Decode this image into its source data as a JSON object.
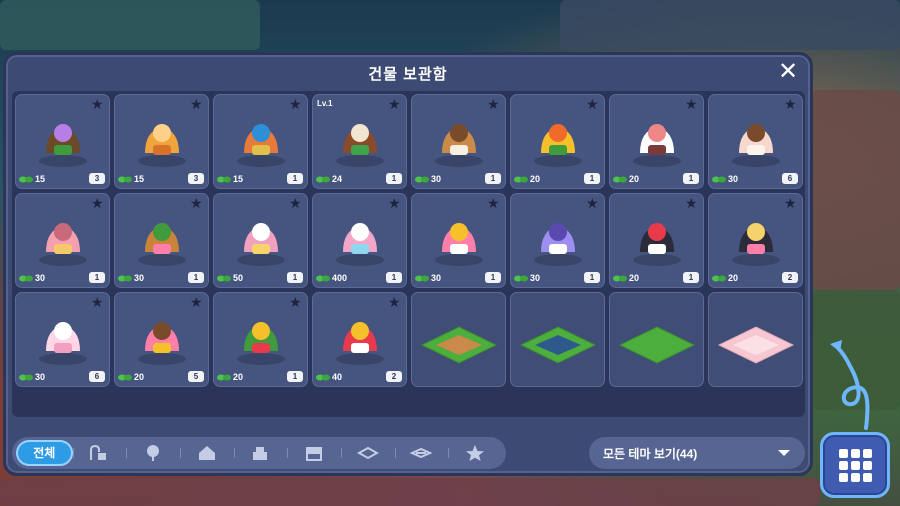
{
  "panel": {
    "title": "건물 보관함",
    "close_icon": "close-icon"
  },
  "items": [
    {
      "name": "flower-bed",
      "price": "15",
      "qty": "3",
      "level": "",
      "colors": [
        "#6b4a2a",
        "#3f9b3b",
        "#b77ee6"
      ]
    },
    {
      "name": "arch-bench",
      "price": "15",
      "qty": "3",
      "level": "",
      "colors": [
        "#f0a53c",
        "#d7722a",
        "#ffd08a"
      ]
    },
    {
      "name": "swing-set",
      "price": "15",
      "qty": "1",
      "level": "",
      "colors": [
        "#e57a3a",
        "#e0c04a",
        "#2d8fd6"
      ]
    },
    {
      "name": "gingerbread-house",
      "price": "24",
      "qty": "1",
      "level": "Lv.1",
      "colors": [
        "#8a4b2a",
        "#3fa34a",
        "#f3e6d0"
      ]
    },
    {
      "name": "sofa-bench",
      "price": "30",
      "qty": "1",
      "level": "",
      "colors": [
        "#c98a4a",
        "#f7efe0",
        "#7a4b2a"
      ]
    },
    {
      "name": "yellow-flowers",
      "price": "20",
      "qty": "1",
      "level": "",
      "colors": [
        "#f5c02a",
        "#3f9b3b",
        "#f06a2a"
      ]
    },
    {
      "name": "white-cat",
      "price": "20",
      "qty": "1",
      "level": "",
      "colors": [
        "#ffffff",
        "#7a3a3a",
        "#e88"
      ]
    },
    {
      "name": "cotton-tree",
      "price": "30",
      "qty": "6",
      "level": "",
      "colors": [
        "#f7d8cc",
        "#fff3ee",
        "#7a4b2a"
      ]
    },
    {
      "name": "pink-radio",
      "price": "30",
      "qty": "1",
      "level": "",
      "colors": [
        "#f5a0b0",
        "#f5c96a",
        "#c86a7a"
      ]
    },
    {
      "name": "flower-basket",
      "price": "30",
      "qty": "1",
      "level": "",
      "colors": [
        "#c9843a",
        "#ff7fa8",
        "#3f9b3b"
      ]
    },
    {
      "name": "picnic-mat",
      "price": "50",
      "qty": "1",
      "level": "",
      "colors": [
        "#f2a0c0",
        "#f7d36a",
        "#ffffff"
      ]
    },
    {
      "name": "cake-fountain",
      "price": "400",
      "qty": "1",
      "level": "",
      "colors": [
        "#f4a6c8",
        "#8fd6f0",
        "#ffffff"
      ]
    },
    {
      "name": "drum-set",
      "price": "30",
      "qty": "1",
      "level": "",
      "colors": [
        "#ff7fa8",
        "#ffffff",
        "#f5c02a"
      ]
    },
    {
      "name": "keyboard",
      "price": "30",
      "qty": "1",
      "level": "",
      "colors": [
        "#9e8ef0",
        "#ffffff",
        "#5a4ab0"
      ]
    },
    {
      "name": "penguin-figure",
      "price": "20",
      "qty": "1",
      "level": "",
      "colors": [
        "#2b2b3a",
        "#ffffff",
        "#e83a4a"
      ]
    },
    {
      "name": "stage-light",
      "price": "20",
      "qty": "2",
      "level": "",
      "colors": [
        "#2b2b3a",
        "#ff7fa8",
        "#f5d36a"
      ]
    },
    {
      "name": "pink-fence",
      "price": "30",
      "qty": "6",
      "level": "",
      "colors": [
        "#ffd6e6",
        "#f2a0c0",
        "#ffffff"
      ]
    },
    {
      "name": "pink-stool",
      "price": "20",
      "qty": "5",
      "level": "",
      "colors": [
        "#ff7fa8",
        "#f5c02a",
        "#7a4b2a"
      ]
    },
    {
      "name": "gift-bag",
      "price": "20",
      "qty": "1",
      "level": "",
      "colors": [
        "#3f9b3b",
        "#e83a4a",
        "#f5c02a"
      ]
    },
    {
      "name": "circus-tent",
      "price": "40",
      "qty": "2",
      "level": "",
      "colors": [
        "#e83a4a",
        "#ffffff",
        "#f5c02a"
      ]
    },
    {
      "name": "dirt-tile",
      "price": "",
      "qty": "",
      "level": "",
      "colors": [
        "#4cae3c",
        "#c98a4a",
        "#3d8e2e"
      ]
    },
    {
      "name": "pond-tile",
      "price": "",
      "qty": "",
      "level": "",
      "colors": [
        "#4cae3c",
        "#2d5a8a",
        "#3d8e2e"
      ]
    },
    {
      "name": "grass-tile",
      "price": "",
      "qty": "",
      "level": "",
      "colors": [
        "#4cae3c",
        "#4cae3c",
        "#3d8e2e"
      ]
    },
    {
      "name": "pink-tile",
      "price": "",
      "qty": "",
      "level": "",
      "colors": [
        "#f7c7d2",
        "#fbe0e6",
        "#e6a9b8"
      ]
    }
  ],
  "filters": {
    "all_label": "전체",
    "icons": [
      "decor-icon",
      "tree-icon",
      "house-icon",
      "cake-building-icon",
      "shop-icon",
      "fence-icon",
      "path-icon",
      "star-icon"
    ]
  },
  "sort": {
    "label": "모든 테마 보기(44)",
    "icon": "chevron-down-icon"
  },
  "menu_button": {
    "icon": "grid-icon"
  },
  "colors": {
    "panel": "#3d4a74",
    "card": "#46557f",
    "accent": "#2d9be6",
    "leaf": "#4cc34a"
  }
}
